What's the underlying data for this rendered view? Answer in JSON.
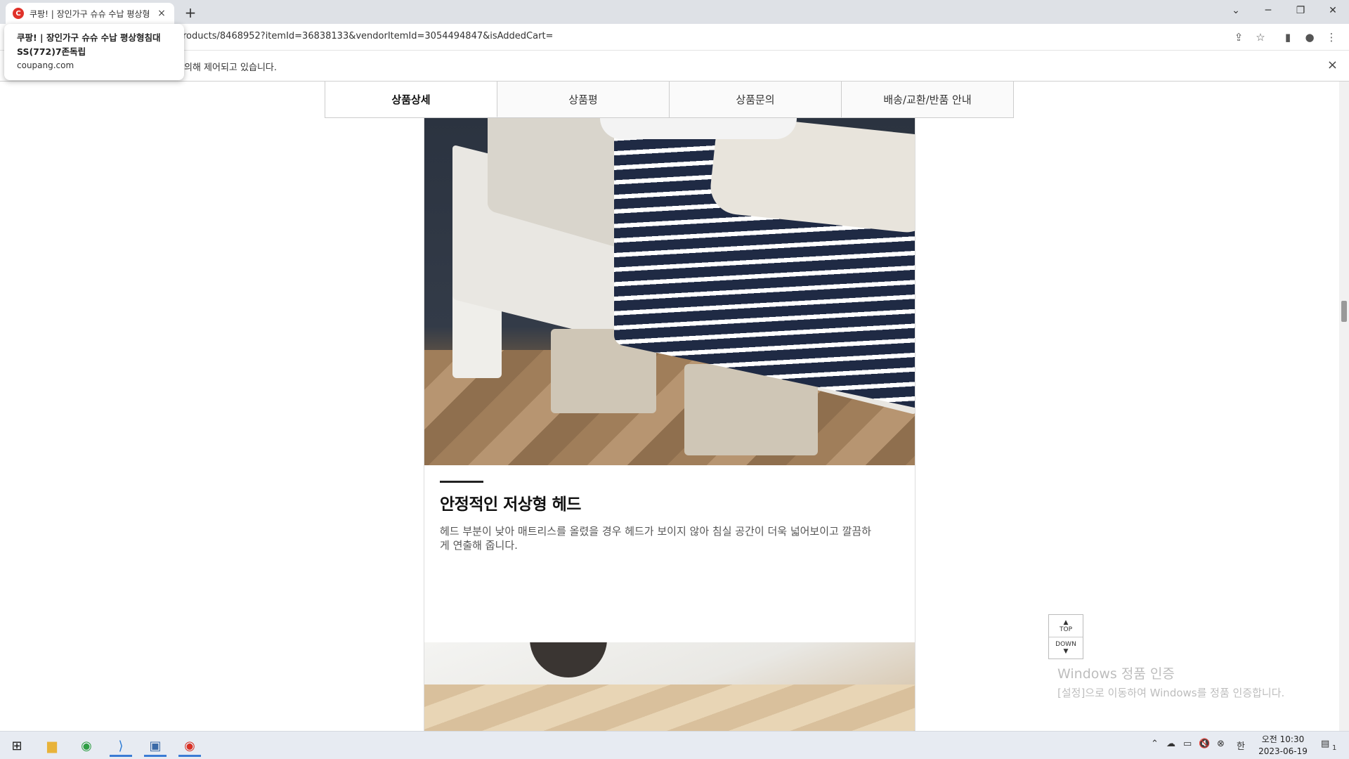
{
  "browser": {
    "tab_title": "쿠팡! | 장인가구 슈슈 수납 평상형",
    "tab_favicon": "C",
    "tab_close": "×",
    "new_tab": "+",
    "url": "roducts/8468952?itemId=36838133&vendorItemId=3054494847&isAddedCart=",
    "infobar_message": "의해 제어되고 있습니다.",
    "infobar_close": "×",
    "hovercard": {
      "title": "쿠팡! | 장인가구 슈슈 수납 평상형침대 SS(772)7존독립",
      "domain": "coupang.com"
    }
  },
  "product_tabs": [
    {
      "label": "상품상세",
      "active": true
    },
    {
      "label": "상품평",
      "active": false
    },
    {
      "label": "상품문의",
      "active": false
    },
    {
      "label": "배송/교환/반품 안내",
      "active": false
    }
  ],
  "detail": {
    "headline": "안정적인 저상형 헤드",
    "description": "헤드 부분이 낮아 매트리스를 올렸을 경우 헤드가 보이지 않아 침실 공간이 더욱 넓어보이고 깔끔하게 연출해 줍니다."
  },
  "floating": {
    "top": "TOP",
    "down": "DOWN"
  },
  "watermark": {
    "line1": "Windows 정품 인증",
    "line2": "[설정]으로 이동하여 Windows를 정품 인증합니다."
  },
  "taskbar": {
    "time": "오전 10:30",
    "date": "2023-06-19",
    "ime": "한",
    "notification_count": "1"
  },
  "colors": {
    "coupang_red": "#e0322a",
    "taskbar_bg": "#e7ebf2"
  }
}
